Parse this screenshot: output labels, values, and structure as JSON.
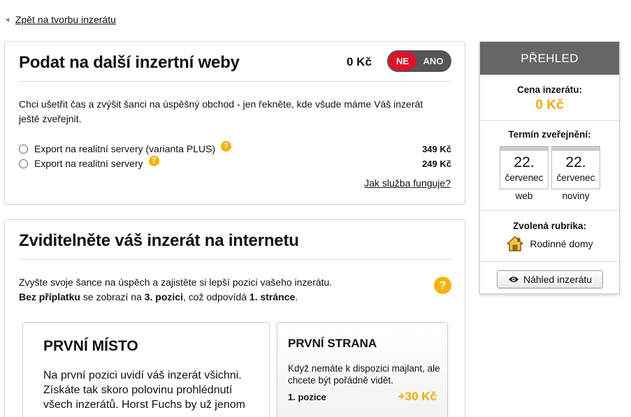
{
  "nav": {
    "back_label": "Zpět na tvorbu inzerátu"
  },
  "export_section": {
    "title": "Podat na další inzertní weby",
    "price": "0 Kč",
    "toggle": {
      "off_label": "NE",
      "on_label": "ANO",
      "state": "NE"
    },
    "description": "Chci ušetřit čas a zvýšit šanci na úspěšný obchod - jen řekněte, kde všude máme Váš inzerát ještě zveřejnit.",
    "options": [
      {
        "label": "Export na realitní servery (varianta PLUS)",
        "price": "349 Kč",
        "help_icon": "?"
      },
      {
        "label": "Export na realitní servery",
        "price": "249 Kč",
        "help_icon": "?"
      }
    ],
    "how_link": "Jak služba funguje?"
  },
  "visibility_section": {
    "title": "Zviditelněte váš inzerát na internetu",
    "intro_line1": "Zvyšte svoje šance na úspěch a zajistěte si lepší pozici vašeho inzerátu.",
    "intro_bold1": "Bez příplatku",
    "intro_mid": " se zobrazí na ",
    "intro_bold2": "3. pozici",
    "intro_mid2": ", což odpovídá ",
    "intro_bold3": "1. stránce",
    "intro_end": ".",
    "help_icon": "?",
    "first_place": {
      "title": "PRVNÍ MÍSTO",
      "description": "Na první pozici uvidí váš inzerát všichni. Získáte tak skoro polovinu prohlédnutí všech inzerátů. Horst Fuchs by už jenom"
    },
    "first_page": {
      "title": "PRVNÍ STRANA",
      "description": "Když nemáte k dispozici majlant, ale chcete být pořádně vidět.",
      "position": "1. pozice",
      "price": "+30 Kč"
    }
  },
  "summary": {
    "title": "PŘEHLED",
    "price_label": "Cena inzerátu:",
    "price_value": "0 Kč",
    "publish_label": "Termín zveřejnění:",
    "web": {
      "day": "22.",
      "month": "červenec",
      "label": "web"
    },
    "print": {
      "day": "22.",
      "month": "červenec",
      "label": "noviny"
    },
    "category_label": "Zvolená rubrika:",
    "category_value": "Rodinné domy",
    "preview_button": "Náhled inzerátu"
  },
  "colors": {
    "accent": "#f4a900",
    "toggle_off": "#e0112b",
    "header": "#666666"
  },
  "icons": [
    "back-arrow-icon",
    "help-icon",
    "house-icon",
    "eye-icon"
  ]
}
